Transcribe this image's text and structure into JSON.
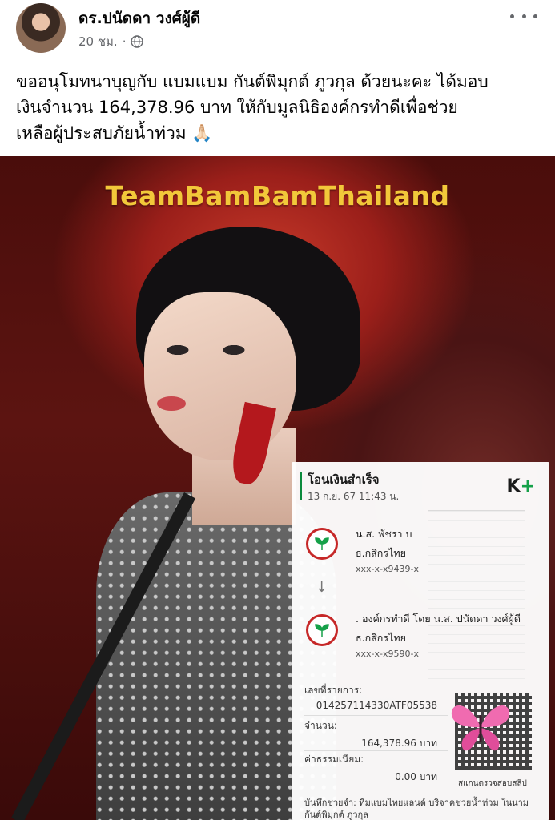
{
  "post": {
    "author": "ดร.ปนัดดา วงศ์ผู้ดี",
    "time": "20 ชม.",
    "separator": "·",
    "text_lines": [
      "ขออนุโมทนาบุญกับ แบมแบม กันต์พิมุกต์ ภูวกุล ด้วยนะคะ ได้มอบ",
      "เงินจำนวน  164,378.96 บาท ให้กับมูลนิธิองค์กรทำดีเพื่อช่วย",
      "เหลือผู้ประสบภัยน้ำท่วม 🙏🏻"
    ]
  },
  "image": {
    "title": "TeamBamBamThailand",
    "receipt": {
      "title": "โอนเงินสำเร็จ",
      "datetime": "13 ก.ย. 67  11:43 น.",
      "logo_main": "K",
      "logo_plus": "+",
      "sender": {
        "name": "น.ส. พัชรา บ",
        "bank": "ธ.กสิกรไทย",
        "account": "xxx-x-x9439-x"
      },
      "arrow": "↓",
      "receiver": {
        "name": ". องค์กรทำดี โดย น.ส. ปนัดดา  วงศ์ผู้ดี",
        "bank": "ธ.กสิกรไทย",
        "account": "xxx-x-x9590-x"
      },
      "ref_label": "เลขที่รายการ:",
      "ref_value": "014257114330ATF05538",
      "amount_label": "จำนวน:",
      "amount_value": "164,378.96 บาท",
      "fee_label": "ค่าธรรมเนียม:",
      "fee_value": "0.00 บาท",
      "qr_caption": "สแกนตรวจสอบสลิป",
      "note": "บันทึกช่วยจำ: ทีมแบมไทยแลนด์ บริจาคช่วยน้ำท่วม ในนาม กันต์พิมุกต์ ภูวกุล"
    }
  },
  "colors": {
    "gold": "#f2c83a",
    "kbank_green": "#15a149",
    "kbank_red": "#c62828"
  }
}
